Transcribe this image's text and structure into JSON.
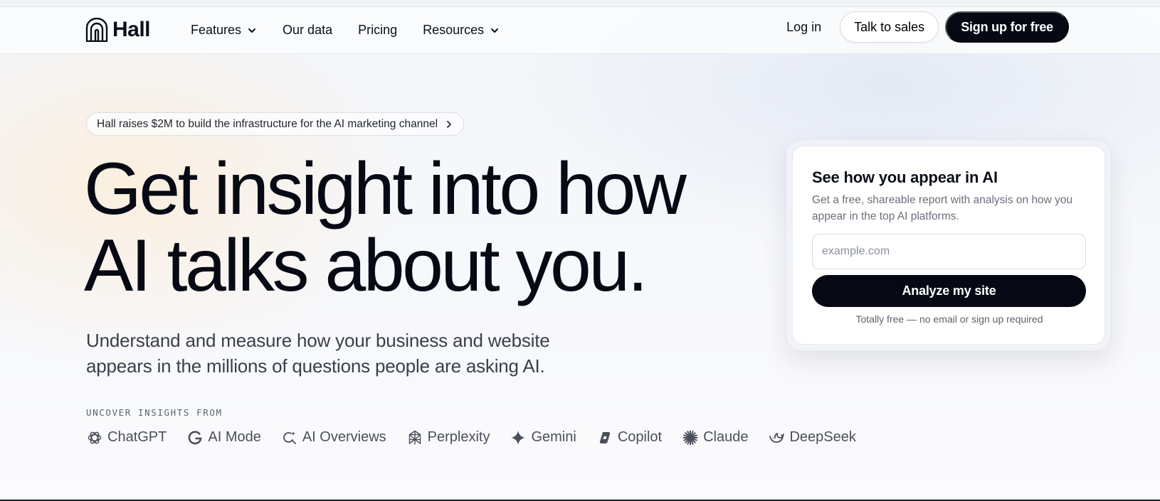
{
  "brand": {
    "name": "Hall",
    "logo_icon": "arch-logo-icon"
  },
  "nav": {
    "items": [
      {
        "label": "Features",
        "has_dropdown": true
      },
      {
        "label": "Our data",
        "has_dropdown": false
      },
      {
        "label": "Pricing",
        "has_dropdown": false
      },
      {
        "label": "Resources",
        "has_dropdown": true
      }
    ],
    "login_label": "Log in",
    "talk_to_sales_label": "Talk to sales",
    "signup_label": "Sign up for free"
  },
  "hero": {
    "announcement": "Hall raises $2M to build the infrastructure for the AI marketing channel",
    "headline_line1": "Get insight into how",
    "headline_line2": "AI talks about you.",
    "subhead_line1": "Understand and measure how your business and website",
    "subhead_line2": "appears in the millions of questions people are asking AI.",
    "uncover_label": "UNCOVER INSIGHTS FROM",
    "platforms": [
      {
        "name": "ChatGPT",
        "icon": "chatgpt-icon"
      },
      {
        "name": "AI Mode",
        "icon": "google-g-icon"
      },
      {
        "name": "AI Overviews",
        "icon": "ai-overviews-icon"
      },
      {
        "name": "Perplexity",
        "icon": "perplexity-icon"
      },
      {
        "name": "Gemini",
        "icon": "gemini-sparkle-icon"
      },
      {
        "name": "Copilot",
        "icon": "copilot-icon"
      },
      {
        "name": "Claude",
        "icon": "claude-asterisk-icon"
      },
      {
        "name": "DeepSeek",
        "icon": "deepseek-whale-icon"
      }
    ]
  },
  "report_card": {
    "title": "See how you appear in AI",
    "description": "Get a free, shareable report with analysis on how you appear in the top AI platforms.",
    "input_placeholder": "example.com",
    "input_value": "",
    "button_label": "Analyze my site",
    "note": "Totally free — no email or sign up required"
  },
  "colors": {
    "primary_dark": "#060913",
    "text": "#0b0f19",
    "muted": "#6a6f7b",
    "border": "#d9dce3"
  }
}
